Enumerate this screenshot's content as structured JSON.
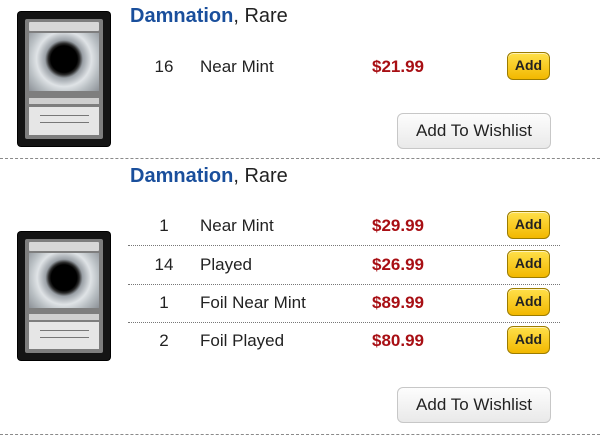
{
  "listings": [
    {
      "card_name": "Damnation",
      "rarity_text": ", Rare",
      "rows": [
        {
          "qty": "16",
          "condition": "Near Mint",
          "price": "$21.99",
          "add_label": "Add"
        }
      ],
      "wishlist_label": "Add To Wishlist"
    },
    {
      "card_name": "Damnation",
      "rarity_text": ", Rare",
      "rows": [
        {
          "qty": "1",
          "condition": "Near Mint",
          "price": "$29.99",
          "add_label": "Add"
        },
        {
          "qty": "14",
          "condition": "Played",
          "price": "$26.99",
          "add_label": "Add"
        },
        {
          "qty": "1",
          "condition": "Foil Near Mint",
          "price": "$89.99",
          "add_label": "Add"
        },
        {
          "qty": "2",
          "condition": "Foil Played",
          "price": "$80.99",
          "add_label": "Add"
        }
      ],
      "wishlist_label": "Add To Wishlist"
    }
  ],
  "colors": {
    "card_name": "#1a4f9c",
    "price": "#a80f14",
    "add_button": "#ffd21f"
  }
}
